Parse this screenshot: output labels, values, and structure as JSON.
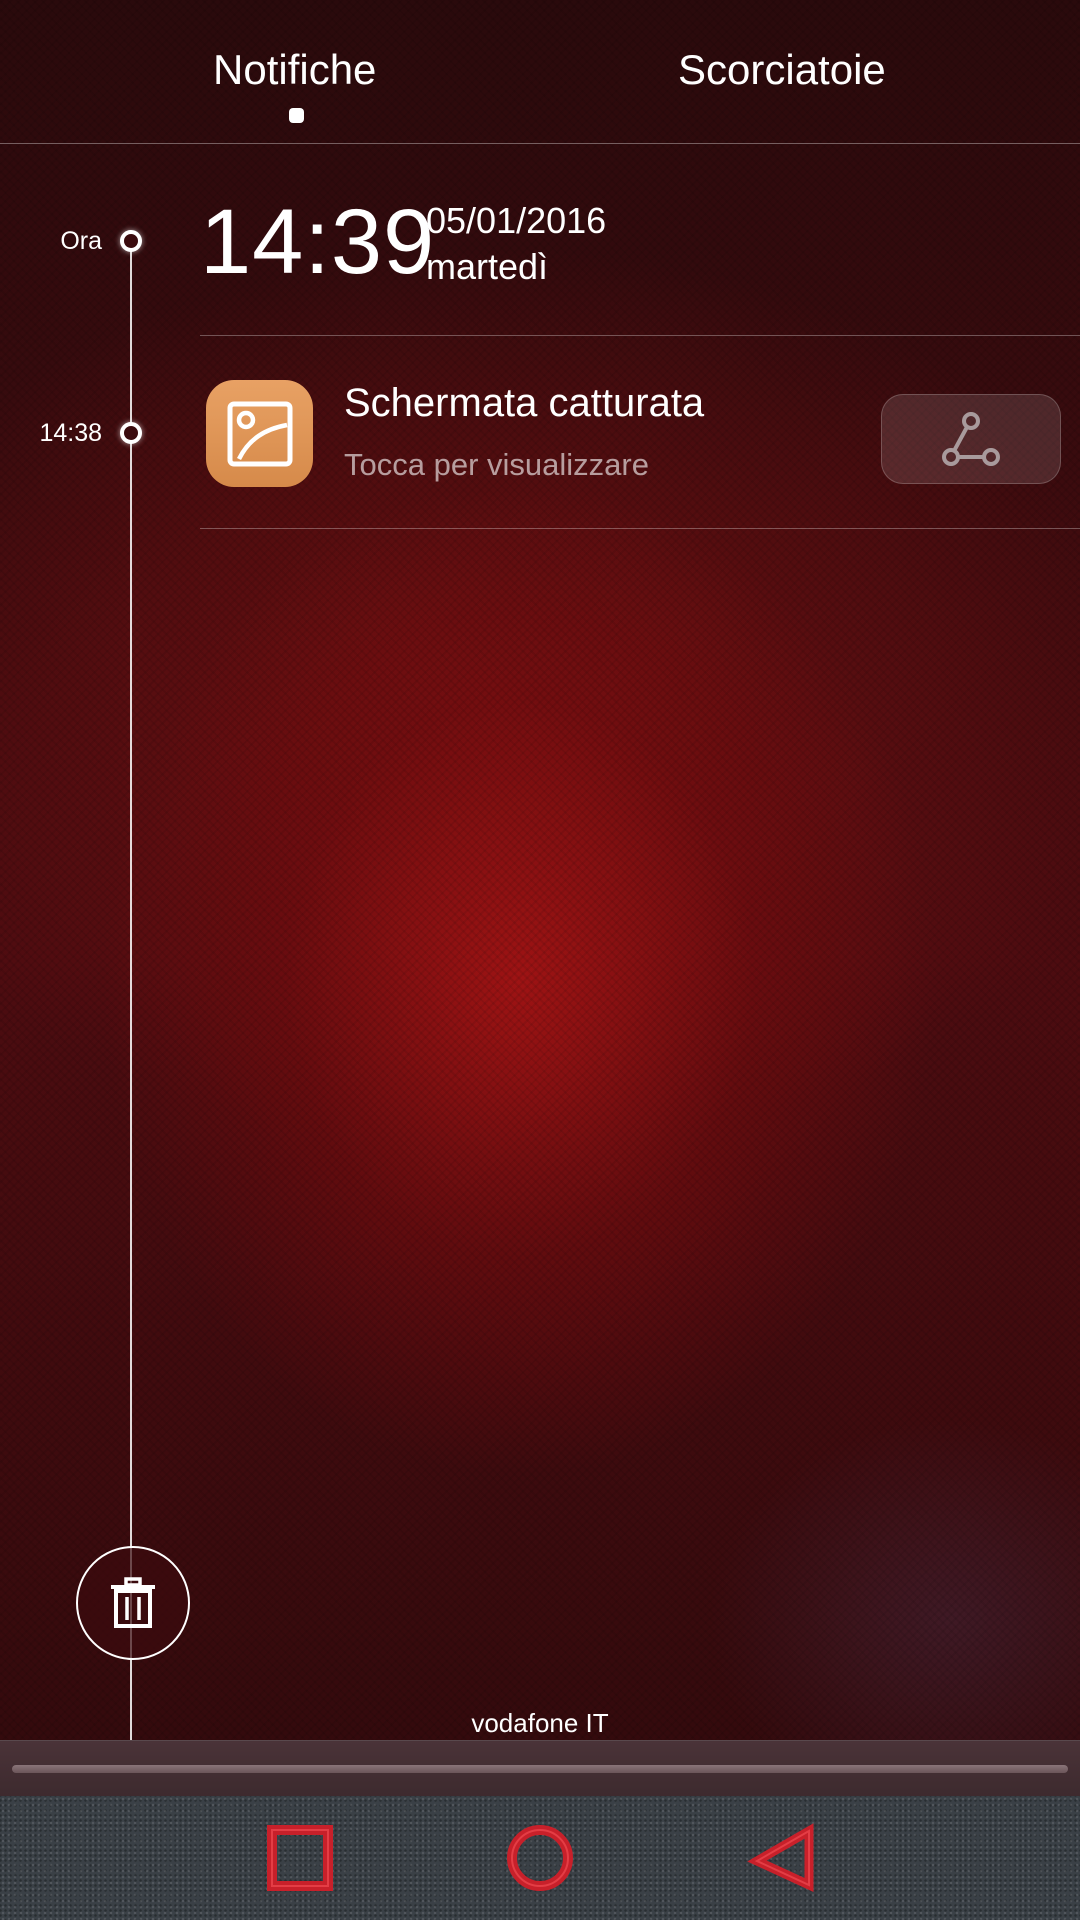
{
  "tabs": {
    "notifiche": "Notifiche",
    "scorciatoie": "Scorciatoie",
    "active": "notifiche"
  },
  "timeline": {
    "now_label": "Ora",
    "entry_time": "14:38"
  },
  "clock": {
    "time": "14:39",
    "date": "05/01/2016",
    "day": "martedì"
  },
  "notification": {
    "title": "Schermata catturata",
    "subtitle": "Tocca per visualizzare",
    "app_icon": "gallery-image-icon",
    "action_icon": "share-icon"
  },
  "carrier": "vodafone IT",
  "icons": {
    "trash": "trash-icon",
    "recents": "square-recents-icon",
    "home": "circle-home-icon",
    "back": "triangle-back-icon"
  },
  "colors": {
    "app_icon_bg": "#e09556",
    "nav_accent": "#c8202a",
    "background": "#4d0c10"
  }
}
